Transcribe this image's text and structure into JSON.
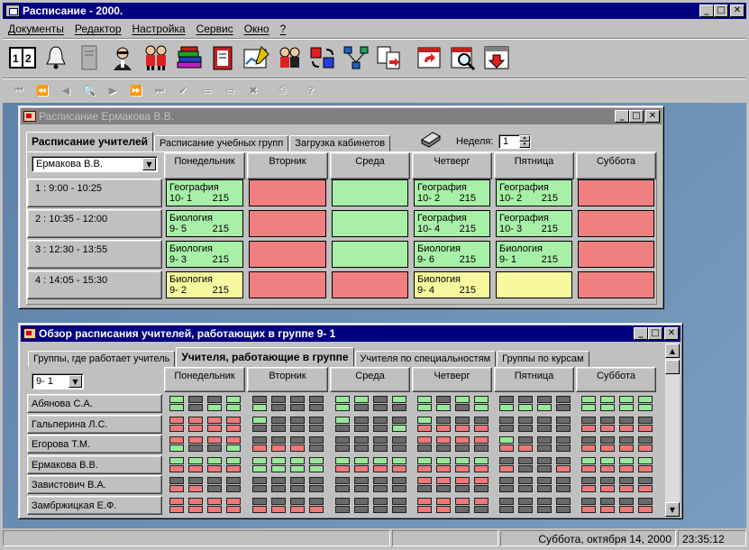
{
  "app": {
    "title": "Расписание - 2000."
  },
  "menu": {
    "items": [
      "Документы",
      "Редактор",
      "Настройка",
      "Сервис",
      "Окно",
      "?"
    ]
  },
  "toolbar": {
    "icons": [
      "schedule-book-icon",
      "bell-icon",
      "server-icon",
      "teacher-icon",
      "students-icon",
      "books-icon",
      "document-icon",
      "chart-edit-icon",
      "people-icon",
      "rotate-cubes-icon",
      "network-icon",
      "document-arrow-icon",
      "calendar-refresh-icon",
      "calendar-search-icon",
      "save-calendar-icon"
    ]
  },
  "nav_toolbar": {
    "buttons": [
      "first-icon",
      "prev-page-icon",
      "prev-icon",
      "search-icon",
      "next-icon",
      "next-page-icon",
      "last-icon",
      "check-icon",
      "blank-icon",
      "blank2-icon",
      "cancel-icon",
      "print-icon",
      "help-icon"
    ]
  },
  "teacher_window": {
    "title": "Расписание Ермакова В.В.",
    "tabs": [
      "Расписание учителей",
      "Расписание учебных групп",
      "Загрузка кабинетов"
    ],
    "week_label": "Неделя:",
    "week_value": "1",
    "teacher_select": "Ермакова В.В.",
    "days": [
      "Понедельник",
      "Вторник",
      "Среда",
      "Четверг",
      "Пятница",
      "Суббота"
    ],
    "periods": [
      "1 :  9:00 - 10:25",
      "2 : 10:35 - 12:00",
      "3 : 12:30 - 13:55",
      "4 : 14:05 - 15:30"
    ],
    "grid": [
      [
        {
          "color": "green",
          "subject": "География",
          "group": "10- 1",
          "room": "215"
        },
        {
          "color": "red"
        },
        {
          "color": "green"
        },
        {
          "color": "green",
          "subject": "География",
          "group": "10- 2",
          "room": "215"
        },
        {
          "color": "green",
          "subject": "География",
          "group": "10- 2",
          "room": "215"
        },
        {
          "color": "red"
        }
      ],
      [
        {
          "color": "green",
          "subject": "Биология",
          "group": "9- 5",
          "room": "215"
        },
        {
          "color": "red"
        },
        {
          "color": "green"
        },
        {
          "color": "green",
          "subject": "География",
          "group": "10- 4",
          "room": "215"
        },
        {
          "color": "green",
          "subject": "География",
          "group": "10- 3",
          "room": "215"
        },
        {
          "color": "red"
        }
      ],
      [
        {
          "color": "green",
          "subject": "Биология",
          "group": "9- 3",
          "room": "215"
        },
        {
          "color": "red"
        },
        {
          "color": "green"
        },
        {
          "color": "green",
          "subject": "Биология",
          "group": "9- 6",
          "room": "215"
        },
        {
          "color": "green",
          "subject": "Биология",
          "group": "9- 1",
          "room": "215"
        },
        {
          "color": "red"
        }
      ],
      [
        {
          "color": "yellow",
          "subject": "Биология",
          "group": "9- 2",
          "room": "215"
        },
        {
          "color": "red"
        },
        {
          "color": "red"
        },
        {
          "color": "yellow",
          "subject": "Биология",
          "group": "9- 4",
          "room": "215"
        },
        {
          "color": "yellow"
        },
        {
          "color": "red"
        }
      ]
    ]
  },
  "overview_window": {
    "title": "Обзор расписания учителей, работающих в группе  9- 1",
    "tabs": [
      "Группы, где работает учитель",
      "Учителя, работающие в группе",
      "Учителя по специальностям",
      "Группы по курсам"
    ],
    "group_select": "9- 1",
    "days": [
      "Понедельник",
      "Вторник",
      "Среда",
      "Четверг",
      "Пятница",
      "Суббота"
    ],
    "teachers": [
      {
        "name": "Абянова С.А.",
        "slots": [
          "gkkg",
          "gkgg",
          "kkkk",
          "gkkk",
          "ggkg",
          "gkkk",
          "gkgg",
          "ggkg",
          "kkkk",
          "gggk",
          "gggg",
          "gggg"
        ]
      },
      {
        "name": "Гальперина Л.С.",
        "slots": [
          "rrrr",
          "rrrr",
          "gkkk",
          "kkkk",
          "gkkk",
          "kkkg",
          "gkkk",
          "rrrr",
          "kkkk",
          "kkkk",
          "kkkk",
          "rrrr"
        ]
      },
      {
        "name": "Егорова Т.М.",
        "slots": [
          "rrrr",
          "gkkg",
          "kkkk",
          "rrrk",
          "kkkk",
          "kkkk",
          "rrrr",
          "kkkk",
          "gkkk",
          "rrkk",
          "kkkk",
          "rrrr"
        ]
      },
      {
        "name": "Ермакова В.В.",
        "slots": [
          "gggg",
          "rrrr",
          "gggg",
          "gggg",
          "gggg",
          "rrrr",
          "gggg",
          "rrrr",
          "kkkk",
          "rkkr",
          "gggg",
          "rrrr"
        ]
      },
      {
        "name": "Завистович В.А.",
        "slots": [
          "kkkk",
          "rrkk",
          "kkkk",
          "kkkk",
          "kkkk",
          "kkkk",
          "rrrr",
          "kkkk",
          "kkkk",
          "kkkk",
          "kkkk",
          "rrrr"
        ]
      },
      {
        "name": "Замбржицкая Е.Ф.",
        "slots": [
          "rrrr",
          "rrrr",
          "kkkk",
          "rrrr",
          "kkkk",
          "kkkk",
          "rrrr",
          "rrkk",
          "kkkk",
          "kkkk",
          "kkkk",
          "rrrr"
        ]
      }
    ]
  },
  "status": {
    "date": "Суббота, октября 14, 2000",
    "time": "23:35:12"
  }
}
